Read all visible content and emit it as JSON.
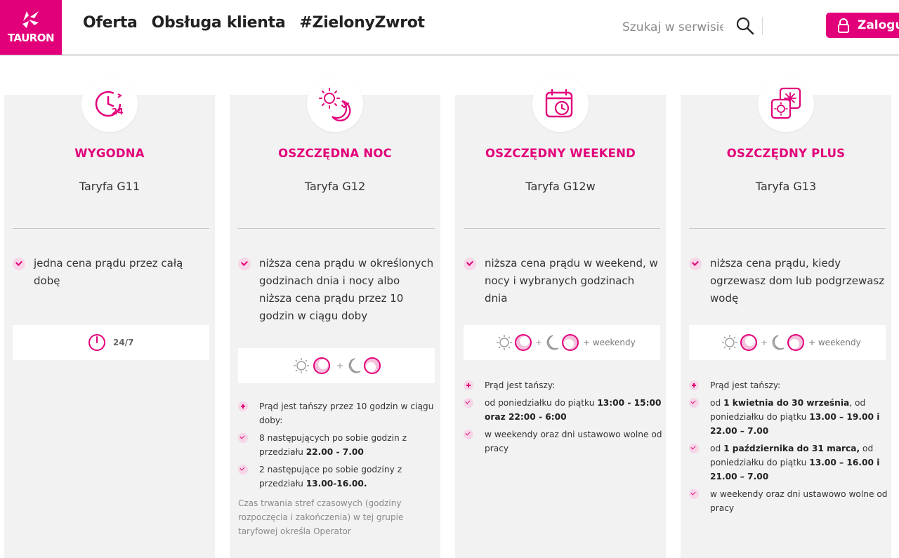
{
  "header": {
    "logo_text": "TAURON",
    "nav": [
      "Oferta",
      "Obsługa klienta",
      "#ZielonyZwrot"
    ],
    "search_placeholder": "Szukaj w serwisie",
    "login_label": "Zaloguj"
  },
  "colors": {
    "brand": "#e2007a",
    "card_bg": "#f2f2f2"
  },
  "cards": [
    {
      "icon": "clock-24-icon",
      "title": "WYGODNA",
      "subtitle": "Taryfa G11",
      "feature": "jedna cena prądu przez całą dobę",
      "badge": "24/7"
    },
    {
      "icon": "sun-moon-icon",
      "title": "OSZCZĘDNA NOC",
      "subtitle": "Taryfa G12",
      "feature": "niższa cena prądu w określonych godzinach dnia i nocy albo niższa cena prądu przez 10 godzin w ciągu doby",
      "details": {
        "intro": "Prąd jest tańszy przez 10 godzin w ciągu doby:",
        "items": [
          [
            "8 następujących po sobie godzin z przedziału ",
            "22.00 - 7.00"
          ],
          [
            "2 następujące po sobie godziny z przedziału ",
            "13.00-16.00."
          ]
        ],
        "note": "Czas trwania stref czasowych (godziny rozpoczęcia i zakończenia) w tej grupie taryfowej określa Operator"
      }
    },
    {
      "icon": "calendar-clock-icon",
      "title": "OSZCZĘDNY WEEKEND",
      "subtitle": "Taryfa G12w",
      "feature": "niższa cena prądu w weekend, w nocy i wybranych godzinach dnia",
      "badge": "+ weekendy",
      "details": {
        "intro": "Prąd jest tańszy:",
        "item1_pre": "od poniedziałku do piątku ",
        "item1_bold": "13:00 - 15:00 oraz 22:00 - 6:00",
        "item2": "w weekendy oraz dni ustawowo wolne od pracy"
      }
    },
    {
      "icon": "sun-snowflake-icon",
      "title": "OSZCZĘDNY PLUS",
      "subtitle": "Taryfa G13",
      "feature": "niższa cena prądu, kiedy ogrzewasz dom lub podgrzewasz wodę",
      "badge": "+ weekendy",
      "details": {
        "intro": "Prąd jest tańszy:",
        "a_pre": "od ",
        "a_bold1": "1 kwietnia do 30 września",
        "a_mid": ", od poniedziałku do piątku ",
        "a_bold2": "13.00 – 19.00 i 22.00 – 7.00",
        "b_pre": "od ",
        "b_bold1": "1 października do 31 marca,",
        "b_mid": " od poniedziałku do piątku ",
        "b_bold2": "13.00 – 16.00 i 21.00 – 7.00",
        "c": "w weekendy oraz dni ustawowo wolne od pracy"
      }
    }
  ]
}
